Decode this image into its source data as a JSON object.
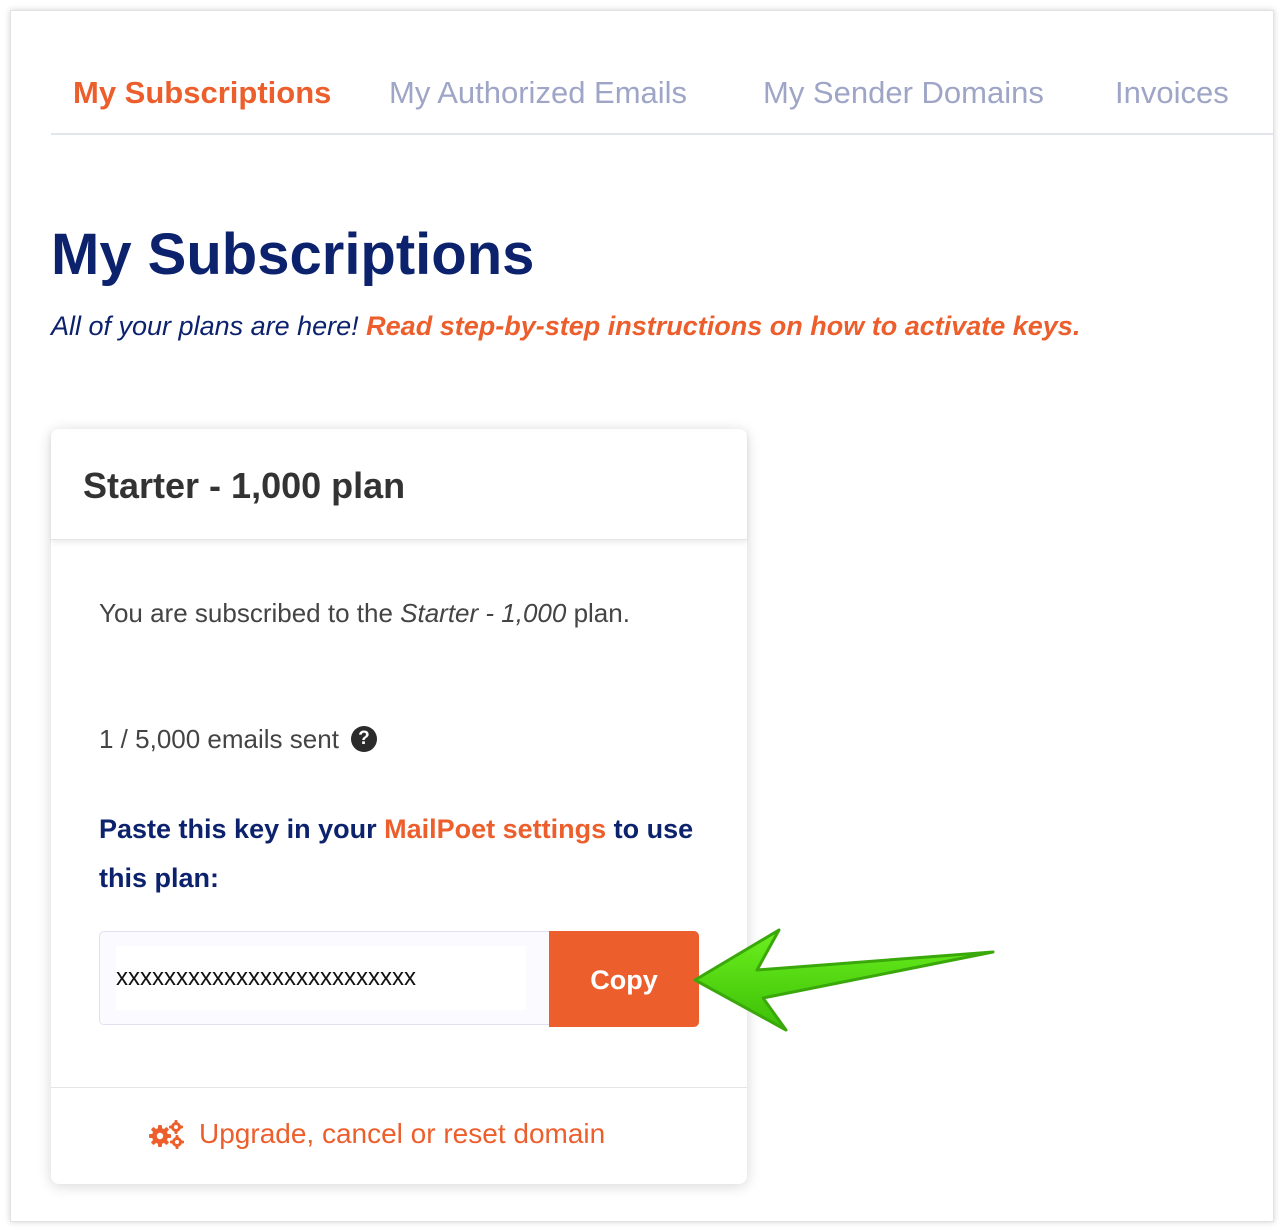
{
  "tabs": [
    {
      "label": "My Subscriptions",
      "active": true
    },
    {
      "label": "My Authorized Emails",
      "active": false
    },
    {
      "label": "My Sender Domains",
      "active": false
    },
    {
      "label": "Invoices",
      "active": false
    }
  ],
  "page": {
    "title": "My Subscriptions",
    "subtitle_text": "All of your plans are here! ",
    "subtitle_link": "Read step-by-step instructions on how to activate keys."
  },
  "card": {
    "plan_name": "Starter - 1,000 plan",
    "subscribed_prefix": "You are subscribed to the ",
    "subscribed_plan": "Starter - 1,000",
    "subscribed_suffix": " plan.",
    "usage": "1 / 5,000 emails sent",
    "help_icon_glyph": "?",
    "paste_prefix": "Paste this key in your ",
    "paste_link": "MailPoet settings",
    "paste_suffix": " to use this plan:",
    "key_value": "xxxxxxxxxxxxxxxxxxxxxxxxx",
    "copy_label": "Copy",
    "footer_link": "Upgrade, cancel or reset domain"
  },
  "colors": {
    "accent": "#ec5f2d",
    "navy": "#0c226d",
    "tab_inactive": "#9ea5c6",
    "arrow": "#4cd80a"
  },
  "icons": {
    "help": "question-circle-icon",
    "footer": "gears-icon",
    "annotation": "green-arrow-icon"
  }
}
